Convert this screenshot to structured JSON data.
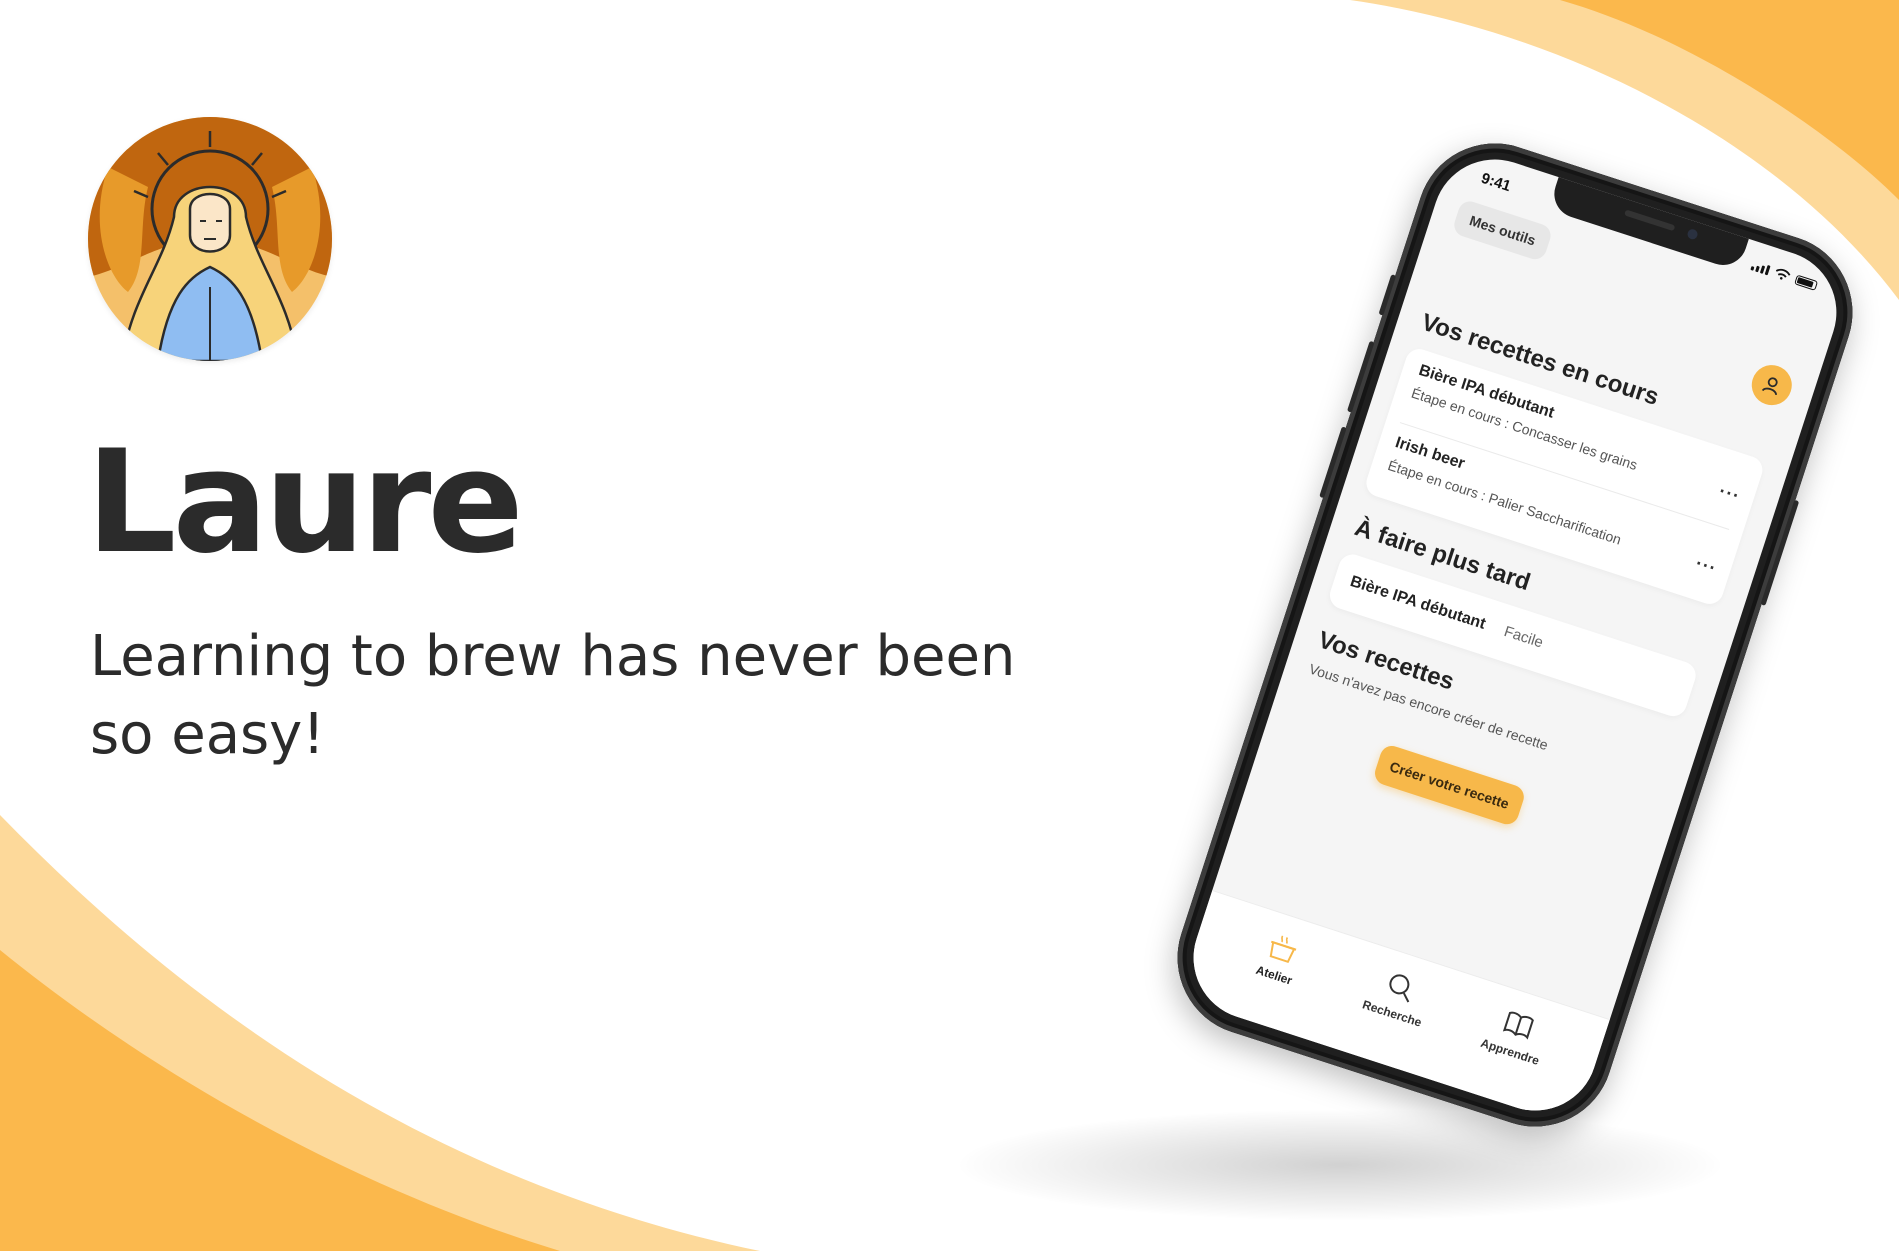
{
  "brand": {
    "name": "Laure",
    "tagline": "Learning to brew has never been so easy!"
  },
  "colors": {
    "accent": "#f7b84a",
    "accent_light": "#fdd99a",
    "text": "#2b2b2b",
    "screen_bg": "#f5f5f5"
  },
  "phone": {
    "status": {
      "time": "9:41"
    },
    "tools_label": "Mes outils",
    "profile_icon": "user-icon",
    "in_progress": {
      "title": "Vos recettes en cours",
      "items": [
        {
          "name": "Bière IPA débutant",
          "step": "Étape en cours : Concasser les grains",
          "menu": "···"
        },
        {
          "name": "Irish beer",
          "step": "Étape en cours : Palier Saccharification",
          "menu": "···"
        }
      ]
    },
    "later": {
      "title": "À faire plus tard",
      "items": [
        {
          "name": "Bière IPA débutant",
          "level": "Facile"
        }
      ]
    },
    "your_recipes": {
      "title": "Vos recettes",
      "empty": "Vous n'avez pas encore créer de recette",
      "create_button": "Créer votre recette"
    },
    "tabs": [
      {
        "label": "Atelier",
        "icon": "cooking-pot-icon",
        "active": true
      },
      {
        "label": "Recherche",
        "icon": "search-icon",
        "active": false
      },
      {
        "label": "Apprendre",
        "icon": "book-icon",
        "active": false
      }
    ]
  }
}
